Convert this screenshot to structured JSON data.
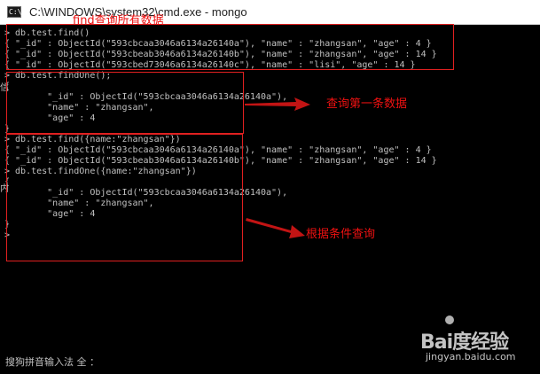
{
  "window": {
    "title": "C:\\WINDOWS\\system32\\cmd.exe - mongo",
    "icon": "cmd-icon",
    "icon_glyph": "C:\\"
  },
  "console": {
    "lines": [
      "> db.test.find()",
      "{ \"_id\" : ObjectId(\"593cbcaa3046a6134a26140a\"), \"name\" : \"zhangsan\", \"age\" : 4 }",
      "{ \"_id\" : ObjectId(\"593cbeab3046a6134a26140b\"), \"name\" : \"zhangsan\", \"age\" : 14 }",
      "{ \"_id\" : ObjectId(\"593cbed73046a6134a26140c\"), \"name\" : \"lisi\", \"age\" : 14 }",
      "> db.test.findOne();",
      "{",
      "        \"_id\" : ObjectId(\"593cbcaa3046a6134a26140a\"),",
      "        \"name\" : \"zhangsan\",",
      "        \"age\" : 4",
      "}",
      "> db.test.find({name:\"zhangsan\"})",
      "{ \"_id\" : ObjectId(\"593cbcaa3046a6134a26140a\"), \"name\" : \"zhangsan\", \"age\" : 4 }",
      "{ \"_id\" : ObjectId(\"593cbeab3046a6134a26140b\"), \"name\" : \"zhangsan\", \"age\" : 14 }",
      "> db.test.findOne({name:\"zhangsan\"})",
      "{",
      "        \"_id\" : ObjectId(\"593cbcaa3046a6134a26140a\"),",
      "        \"name\" : \"zhangsan\",",
      "        \"age\" : 4",
      "}",
      ">"
    ],
    "side_glyphs": [
      "信",
      "内"
    ]
  },
  "annotations": {
    "find_all": "find查询所有数据",
    "find_first": "查询第一条数据",
    "find_by_condition": "根据条件查询",
    "color": "#ee1111"
  },
  "ime_status": "搜狗拼音输入法 全 ：",
  "watermark": {
    "logo": "Bai度经验",
    "url": "jingyan.baidu.com"
  }
}
